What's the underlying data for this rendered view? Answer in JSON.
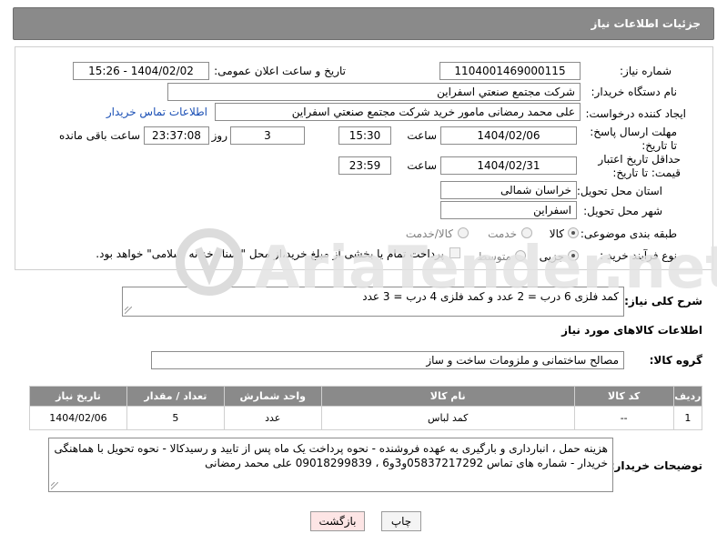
{
  "header": {
    "title": "جزئیات اطلاعات نیاز"
  },
  "form": {
    "need_number_label": "شماره نیاز:",
    "need_number": "1104001469000115",
    "announce_label": "تاریخ و ساعت اعلان عمومی:",
    "announce_value": "1404/02/02 - 15:26",
    "buyer_org_label": "نام دستگاه خریدار:",
    "buyer_org": "شرکت مجتمع صنعتي اسفراين",
    "creator_label": "ایجاد کننده درخواست:",
    "creator": "علی محمد رمضانی مامور خرید شرکت مجتمع صنعتي اسفراين",
    "contact_link": "اطلاعات تماس خریدار",
    "deadline_label": "مهلت ارسال پاسخ: تا تاریخ:",
    "deadline_date": "1404/02/06",
    "time_label": "ساعت",
    "deadline_time": "15:30",
    "days_value": "3",
    "days_label": "روز و",
    "remaining_time": "23:37:08",
    "remaining_label": "ساعت باقی مانده",
    "validity_label": "حداقل تاریخ اعتبار قیمت: تا تاریخ:",
    "validity_date": "1404/02/31",
    "validity_time_label": "ساعت",
    "validity_time": "23:59",
    "province_label": "استان محل تحویل:",
    "province": "خراسان شمالی",
    "city_label": "شهر محل تحویل:",
    "city": "اسفراين",
    "category_label": "طبقه بندی موضوعی:",
    "category_options": [
      "کالا",
      "خدمت",
      "کالا/خدمت"
    ],
    "process_label": "نوع فرآیند خرید :",
    "process_options": [
      "جزیی",
      "متوسط"
    ],
    "payment_note": "پرداخت تمام یا بخشی از مبلغ خرید،از محل \"اسناد خزانه اسلامی\" خواهد بود."
  },
  "summary": {
    "label": "شرح کلی نیاز:",
    "text": "کمد فلزی 6 درب = 2 عدد و کمد فلزی 4 درب = 3 عدد"
  },
  "goods": {
    "section_title": "اطلاعات کالاهای مورد نیاز",
    "group_label": "گروه کالا:",
    "group_value": "مصالح ساختمانی و ملزومات ساخت و ساز",
    "columns": [
      "ردیف",
      "کد کالا",
      "نام کالا",
      "واحد شمارش",
      "تعداد / مقدار",
      "تاریخ نیاز"
    ],
    "rows": [
      [
        "1",
        "--",
        "کمد لباس",
        "عدد",
        "5",
        "1404/02/06"
      ]
    ]
  },
  "buyer_notes": {
    "label": "توضیحات خریدار:",
    "text": "هزینه حمل ، انبارداری و بارگیری به عهده فروشنده - نحوه پرداخت یک ماه پس از تایید و رسیدکالا - نحوه تحویل با هماهنگی خریدار - شماره های تماس 05837217292و3و6 ، 09018299839 علی محمد رمضانی"
  },
  "buttons": {
    "print": "چاپ",
    "back": "بازگشت"
  },
  "watermark": {
    "text": "AriaTender.net"
  },
  "colors": {
    "header_bg": "#8a8a8a",
    "link": "#1a4fb5",
    "back_button_bg": "#fde5e5"
  }
}
